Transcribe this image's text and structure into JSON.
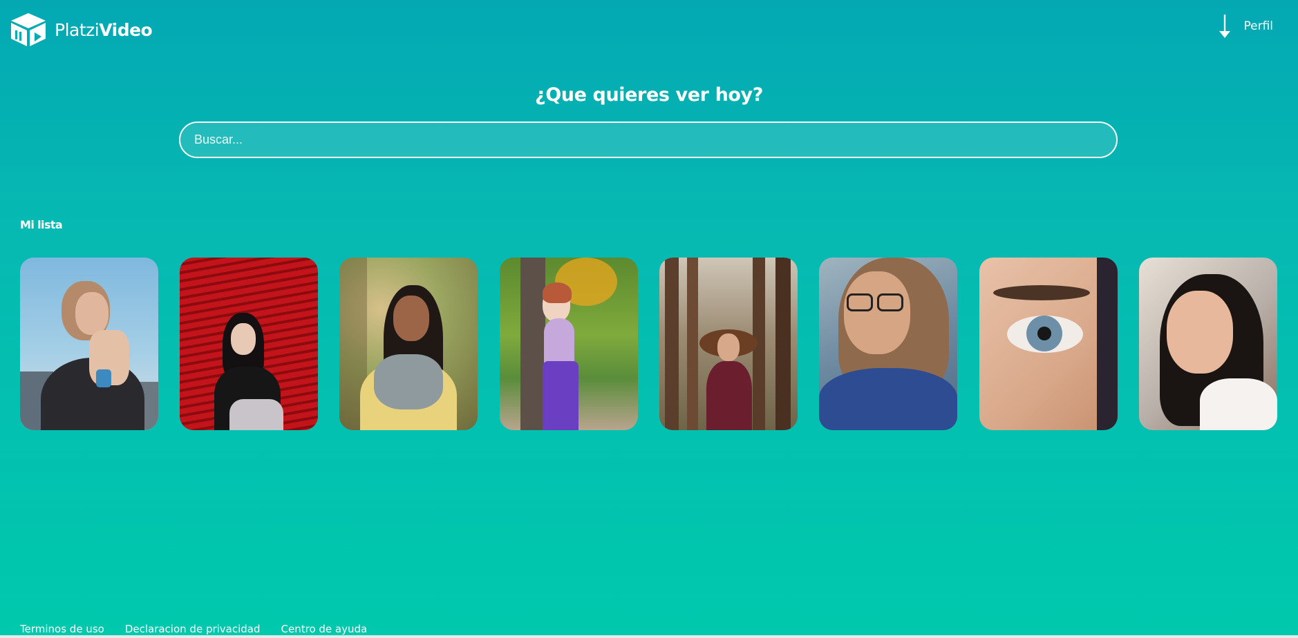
{
  "header": {
    "logo": {
      "brand_light": "Platzi",
      "brand_bold": "Video",
      "icon": "cube-play-icon"
    },
    "profile": {
      "label": "Perfil",
      "icon": "arrow-down-icon"
    }
  },
  "hero": {
    "title": "¿Que quieres ver hoy?",
    "search": {
      "placeholder": "Buscar...",
      "value": ""
    }
  },
  "my_list": {
    "title": "Mi lista",
    "items": [
      {
        "name": "thumbnail-woman-city-sky"
      },
      {
        "name": "thumbnail-woman-red-shutter"
      },
      {
        "name": "thumbnail-woman-park-yellow"
      },
      {
        "name": "thumbnail-woman-tree-purple"
      },
      {
        "name": "thumbnail-woman-forest"
      },
      {
        "name": "thumbnail-woman-glasses"
      },
      {
        "name": "thumbnail-eye-closeup"
      },
      {
        "name": "thumbnail-woman-freckles"
      }
    ]
  },
  "footer": {
    "links": [
      "Terminos de uso",
      "Declaracion de privacidad",
      "Centro de ayuda"
    ]
  },
  "colors": {
    "bg_top": "#03a8b3",
    "bg_bottom": "#00c9ad",
    "text": "#ffffff"
  }
}
